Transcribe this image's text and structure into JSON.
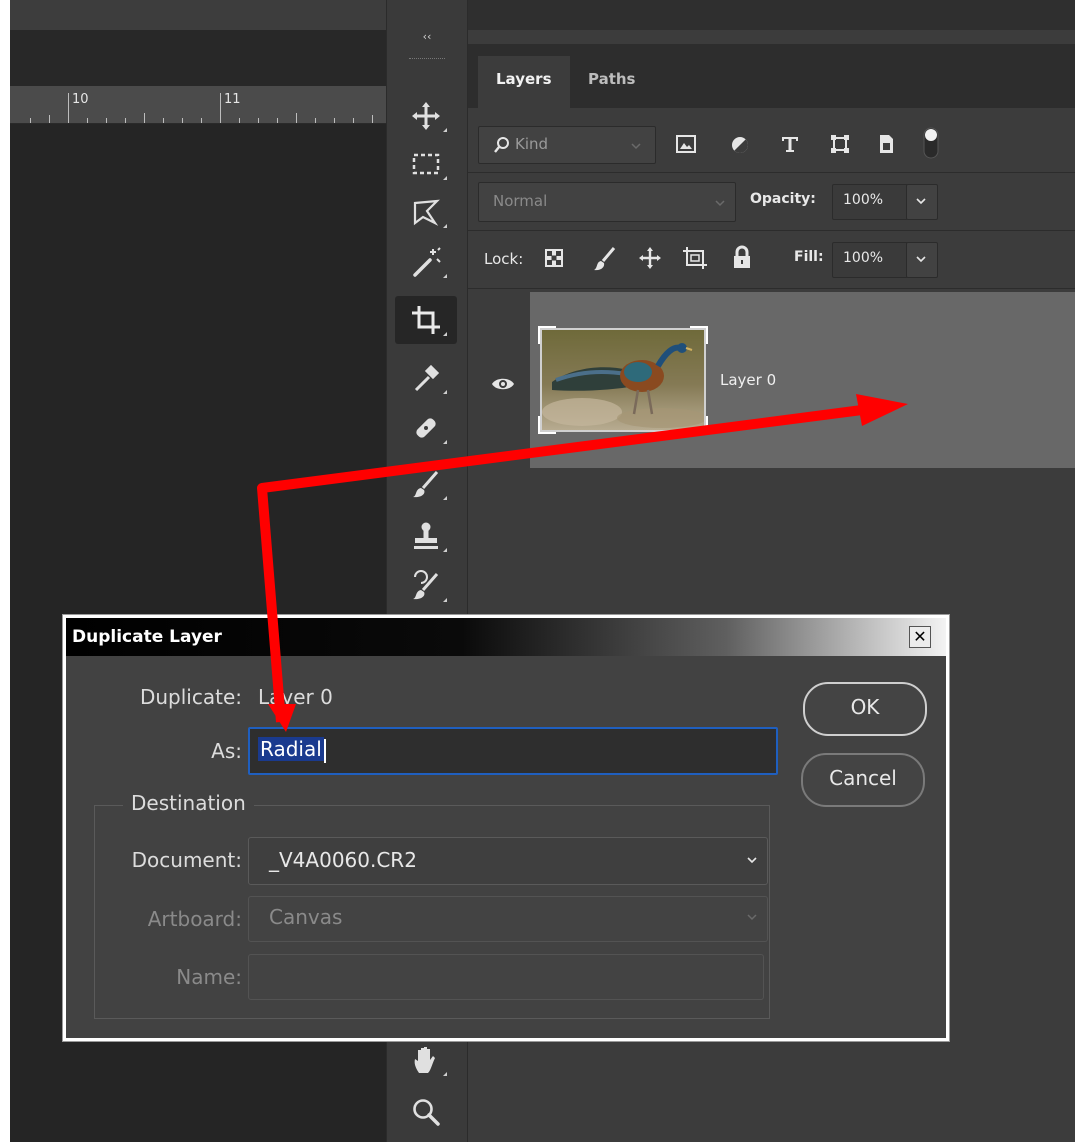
{
  "ruler": {
    "labels": [
      "10",
      "11"
    ]
  },
  "toolbar": {
    "collapse_glyph": "‹‹",
    "tools": [
      "move-tool",
      "marquee-tool",
      "lasso-tool",
      "magic-wand-tool",
      "crop-tool",
      "eyedropper-tool",
      "healing-brush-tool",
      "brush-tool",
      "clone-stamp-tool",
      "history-brush-tool",
      "hand-tool",
      "zoom-tool"
    ],
    "active_tool": "crop-tool"
  },
  "panel": {
    "tabs": [
      {
        "label": "Layers"
      },
      {
        "label": "Paths"
      }
    ],
    "filter": {
      "label": "Kind"
    },
    "blend": {
      "mode": "Normal",
      "opacity_label": "Opacity:",
      "opacity_value": "100%"
    },
    "lock": {
      "label": "Lock:",
      "fill_label": "Fill:",
      "fill_value": "100%"
    },
    "layer": {
      "name": "Layer 0"
    }
  },
  "dialog": {
    "title": "Duplicate Layer",
    "close_glyph": "✕",
    "duplicate_label": "Duplicate:",
    "duplicate_value": "Layer 0",
    "as_label": "As:",
    "as_value": "Radial",
    "destination_label": "Destination",
    "document_label": "Document:",
    "document_value": "_V4A0060.CR2",
    "artboard_label": "Artboard:",
    "artboard_value": "Canvas",
    "name_label": "Name:",
    "name_value": "",
    "ok_label": "OK",
    "cancel_label": "Cancel"
  },
  "colors": {
    "accent_blue": "#1f5fbf",
    "annotation_red": "#ff0000",
    "panel_bg": "#3c3c3c",
    "layer_selected": "#686868"
  }
}
